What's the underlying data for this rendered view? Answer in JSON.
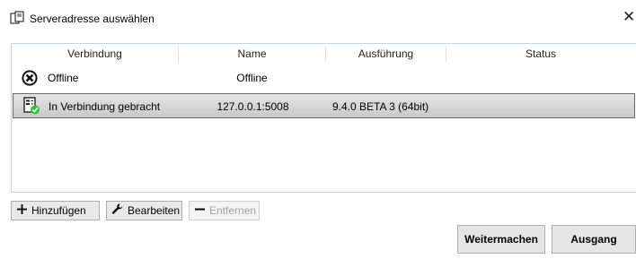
{
  "window": {
    "title": "Serveradresse auswählen",
    "close_glyph": "✕"
  },
  "table": {
    "columns": [
      "Verbindung",
      "Name",
      "Ausführung",
      "Status"
    ],
    "rows": [
      {
        "icon": "offline-icon",
        "verbindung": "Offline",
        "name": "Offline",
        "ausfuehrung": "",
        "status": ""
      },
      {
        "icon": "server-connected-icon",
        "verbindung": "In Verbindung gebracht",
        "name": "127.0.0.1:5008",
        "ausfuehrung": "9.4.0 BETA 3 (64bit)",
        "status": ""
      }
    ],
    "selected_row": 1
  },
  "buttons": {
    "add": "Hinzufügen",
    "edit": "Bearbeiten",
    "remove": "Entfernen",
    "continue": "Weitermachen",
    "exit": "Ausgang"
  },
  "colors": {
    "accent_border": "#bfd5ea",
    "selected_border": "#6b6b6b",
    "status_green": "#2ec43a"
  }
}
